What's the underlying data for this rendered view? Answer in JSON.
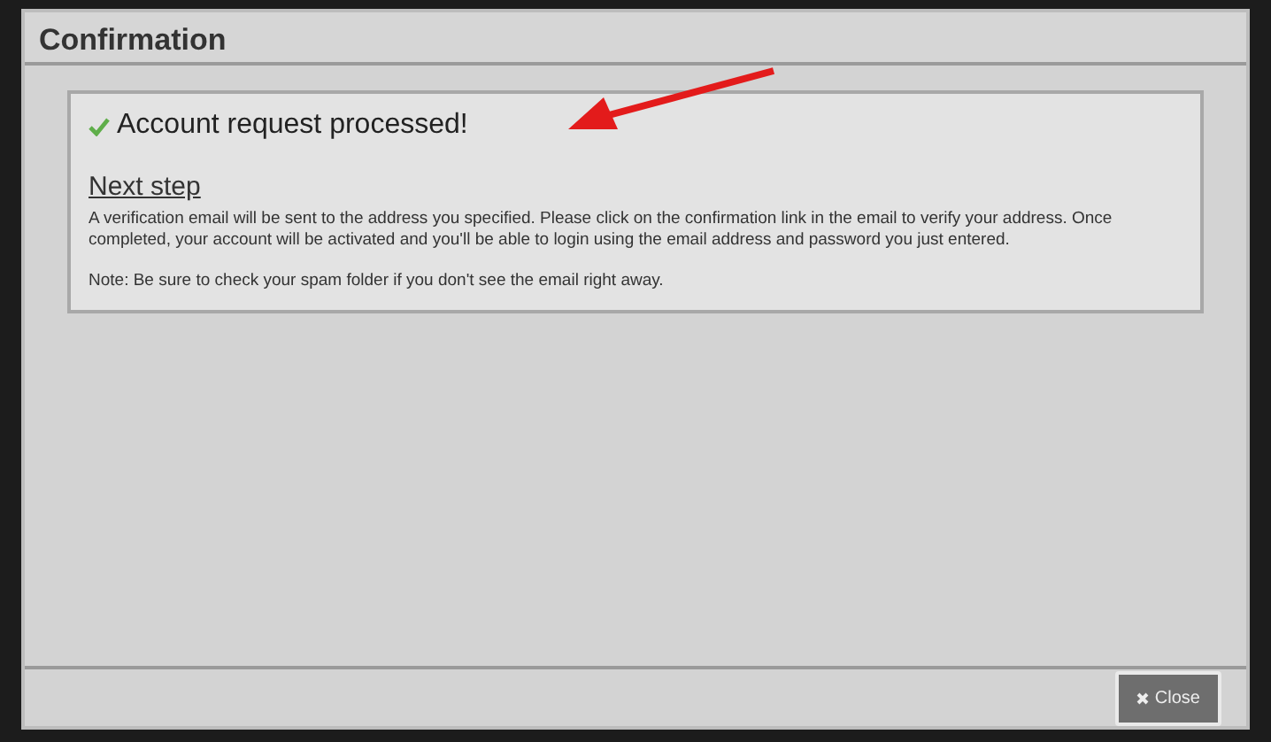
{
  "dialog": {
    "title": "Confirmation",
    "message": {
      "heading": "Account request processed!",
      "subheading": "Next step",
      "paragraphs": [
        "A verification email will be sent to the address you specified. Please click on the confirmation link in the email to verify your address. Once completed, your account will be activated and you'll be able to login using the email address and password you just entered.",
        "Note: Be sure to check your spam folder if you don't see the email right away."
      ]
    },
    "buttons": [
      {
        "label": "Close"
      }
    ]
  }
}
